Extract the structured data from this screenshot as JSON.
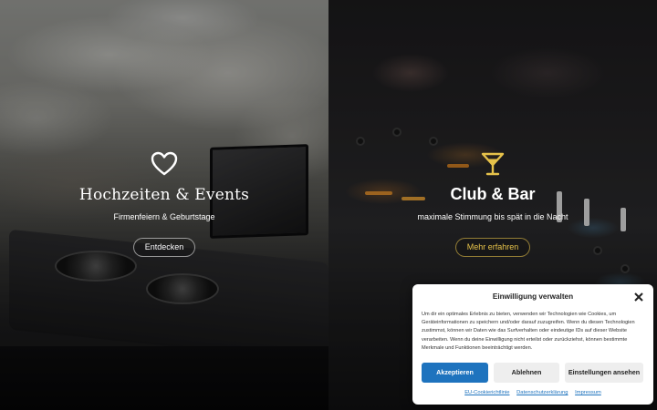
{
  "panels": {
    "left": {
      "icon": "heart-icon",
      "title": "Hochzeiten & Events",
      "subtitle": "Firmenfeiern & Geburtstage",
      "button": "Entdecken"
    },
    "right": {
      "icon": "cocktail-icon",
      "title": "Club & Bar",
      "subtitle": "maximale Stimmung bis spät in die Nacht",
      "button": "Mehr erfahren"
    }
  },
  "consent": {
    "title": "Einwilligung verwalten",
    "body": "Um dir ein optimales Erlebnis zu bieten, verwenden wir Technologien wie Cookies, um Geräteinformationen zu speichern und/oder darauf zuzugreifen. Wenn du diesen Technologien zustimmst, können wir Daten wie das Surfverhalten oder eindeutige IDs auf dieser Website verarbeiten. Wenn du deine Einwilligung nicht erteilst oder zurückziehst, können bestimmte Merkmale und Funktionen beeinträchtigt werden.",
    "accept": "Akzeptieren",
    "deny": "Ablehnen",
    "preferences": "Einstellungen ansehen",
    "links": [
      "EU-Cookierichtlinie",
      "Datenschutzerklärung",
      "Impressum"
    ]
  },
  "colors": {
    "accent_blue": "#1e73be",
    "gold": "#e6c24a"
  }
}
